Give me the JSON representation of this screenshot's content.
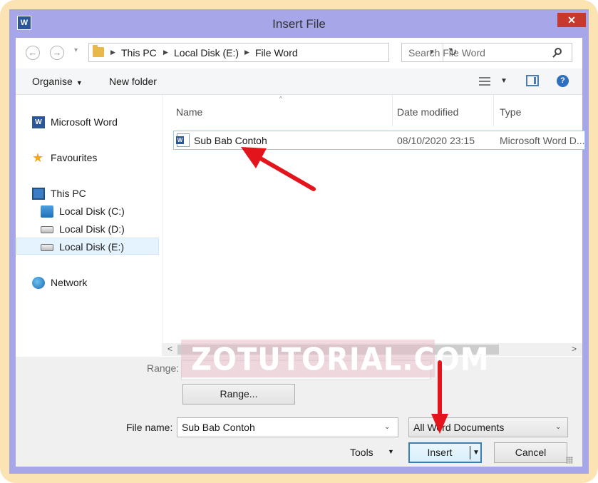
{
  "window": {
    "title": "Insert File",
    "app_icon_letter": "W",
    "close_glyph": "✕"
  },
  "address_bar": {
    "breadcrumbs": [
      "This PC",
      "Local Disk (E:)",
      "File Word"
    ],
    "separator": "▶",
    "back_glyph": "←",
    "forward_glyph": "→",
    "dropdown_glyph": "▾",
    "refresh_glyph": "↻"
  },
  "search": {
    "placeholder": "Search File Word"
  },
  "toolbar": {
    "organise_label": "Organise",
    "new_folder_label": "New folder",
    "caret": "▼",
    "help_glyph": "?"
  },
  "nav_pane": {
    "items": [
      {
        "label": "Microsoft Word",
        "icon": "word-icon"
      },
      {
        "label": "Favourites",
        "icon": "star-icon"
      },
      {
        "label": "This PC",
        "icon": "computer-icon"
      },
      {
        "label": "Local Disk (C:)",
        "icon": "windows-drive-icon"
      },
      {
        "label": "Local Disk (D:)",
        "icon": "drive-icon"
      },
      {
        "label": "Local Disk (E:)",
        "icon": "drive-icon",
        "selected": true
      },
      {
        "label": "Network",
        "icon": "network-icon"
      }
    ],
    "star_glyph": "★"
  },
  "file_list": {
    "columns": [
      "Name",
      "Date modified",
      "Type"
    ],
    "sort_indicator": "^",
    "rows": [
      {
        "name": "Sub Bab Contoh",
        "date_modified": "08/10/2020 23:15",
        "type": "Microsoft Word D..."
      }
    ],
    "doc_icon_letter": "W",
    "scroll_left": "<",
    "scroll_right": ">"
  },
  "bottom_panel": {
    "range_label": "Range:",
    "range_button": "Range...",
    "file_name_label": "File name:",
    "file_name_value": "Sub Bab Contoh",
    "file_type_value": "All Word Documents",
    "tools_label": "Tools",
    "insert_button": "Insert",
    "cancel_button": "Cancel",
    "dropdown_glyph": "⌄"
  },
  "watermark": {
    "text": "ZOTUTORIAL.COM"
  },
  "colors": {
    "frame": "#fbe3b3",
    "window_chrome": "#a6a6e8",
    "close_button": "#c7382d",
    "selection": "#e5f3ff",
    "annotation_arrow": "#e3141b"
  }
}
